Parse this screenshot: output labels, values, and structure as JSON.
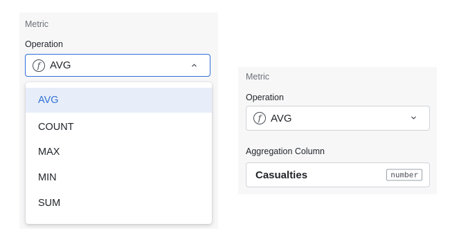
{
  "left": {
    "section_label": "Metric",
    "operation_label": "Operation",
    "selected_value": "AVG",
    "options": [
      "AVG",
      "COUNT",
      "MAX",
      "MIN",
      "SUM"
    ],
    "selected_index": 0
  },
  "right": {
    "section_label": "Metric",
    "operation_label": "Operation",
    "selected_value": "AVG",
    "aggregation_label": "Aggregation Column",
    "aggregation_value": "Casualties",
    "aggregation_type": "number"
  },
  "icons": {
    "function": "function-icon",
    "chevron_up": "chevron-up-icon",
    "chevron_down": "chevron-down-icon"
  },
  "colors": {
    "accent": "#2f6fd6",
    "selected_bg": "#e7eef9",
    "panel_bg": "#f7f7f8"
  }
}
